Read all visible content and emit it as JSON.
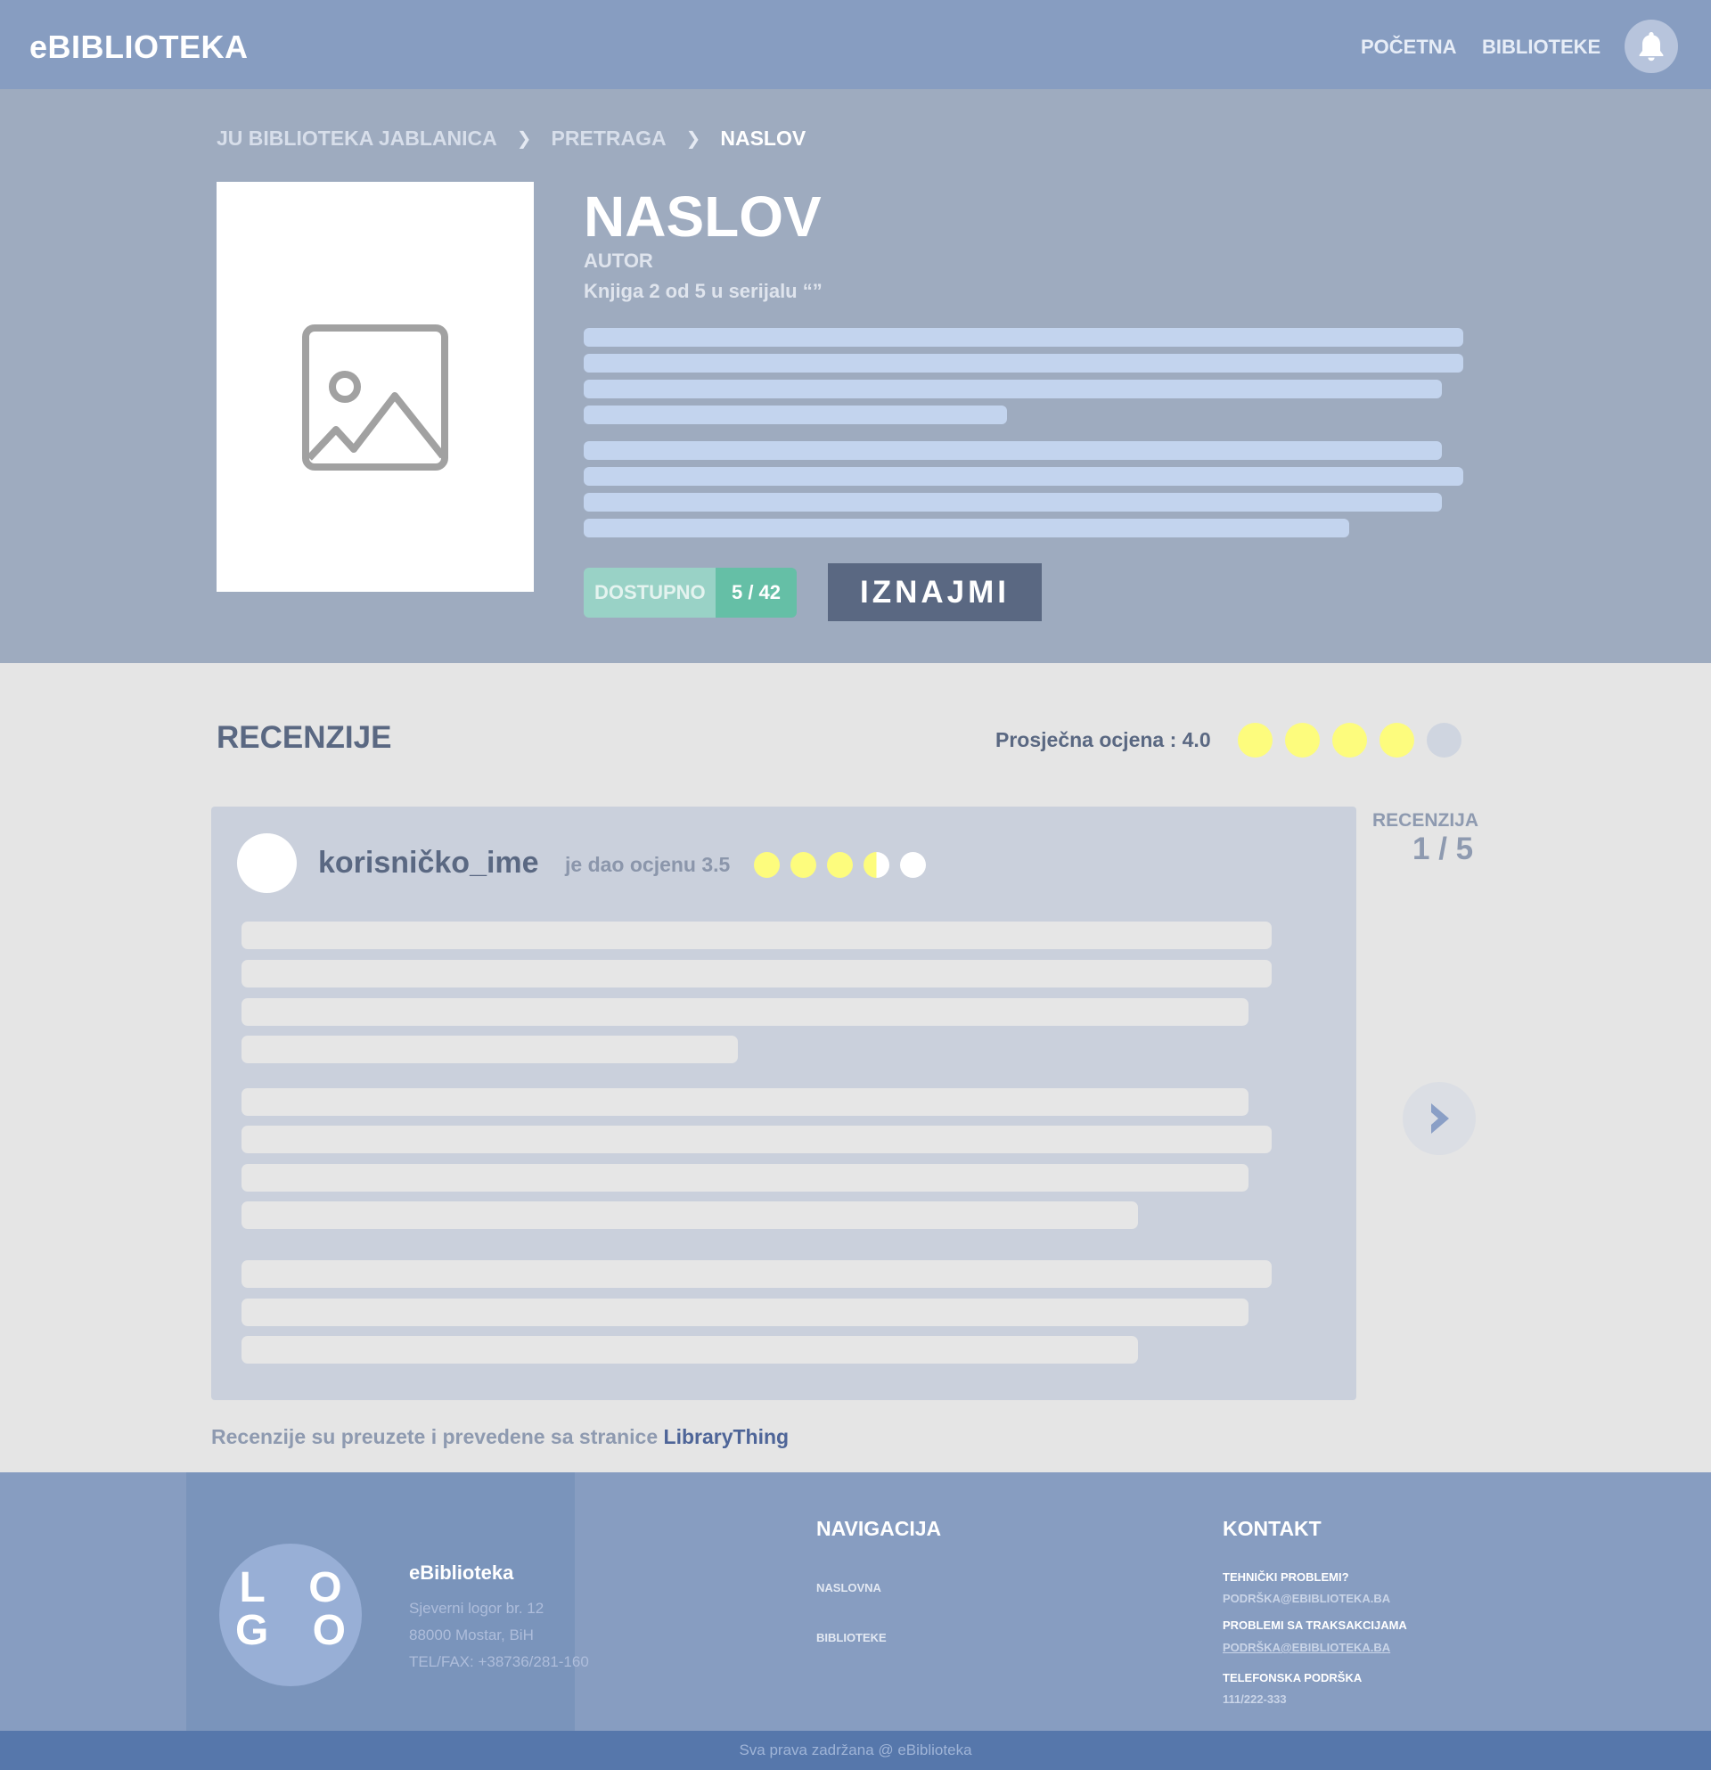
{
  "header": {
    "app_title": "eBIBLIOTEKA",
    "nav": [
      {
        "label": "POČETNA"
      },
      {
        "label": "BIBLIOTEKE"
      }
    ],
    "bell_icon": "bell-icon"
  },
  "breadcrumb": {
    "items": [
      "JU BIBLIOTEKA JABLANICA",
      "PRETRAGA",
      "NASLOV"
    ],
    "separator_icon": "chevron-right-icon"
  },
  "book": {
    "cover_icon": "image-placeholder-icon",
    "title": "NASLOV",
    "author": "AUTOR",
    "series": "Knjiga 2 od 5 u serijalu “”",
    "availability_label": "DOSTUPNO",
    "availability_count": "5 / 42",
    "rent_button": "IZNAJMI"
  },
  "reviews": {
    "heading": "RECENZIJE",
    "average_label": "Prosječna ocjena : 4.0",
    "average_rating": 4.0,
    "max_rating": 5,
    "index_label": "RECENZIJA",
    "index_value": "1 / 5",
    "next_icon": "chevron-right-icon",
    "current": {
      "username": "korisničko_ime",
      "rating_text": "je dao ocjenu 3.5",
      "rating": 3.5
    },
    "source_prefix": "Recenzije su preuzete i prevedene sa stranice",
    "source_link": "LibraryThing"
  },
  "colors": {
    "rating_filled": "#fdfc7d",
    "rating_empty_avg": "#cfd5e0",
    "rating_empty_review": "#ffffff",
    "accent_dark": "#5a6882",
    "available_green": "#65bfa6"
  },
  "footer": {
    "logo_line1": "L O",
    "logo_line2": "G O",
    "brand": "eBiblioteka",
    "address_line1": "Sjeverni logor br. 12",
    "address_line2": "88000 Mostar, BiH",
    "phone_line": "TEL/FAX: +38736/281-160",
    "nav_heading": "NAVIGACIJA",
    "nav_links": [
      "NASLOVNA",
      "BIBLIOTEKE"
    ],
    "contact_heading": "KONTAKT",
    "tech_label": "TEHNIČKI PROBLEMI?",
    "tech_email": "PODRŠKA@EBIBLIOTEKA.BA",
    "trans_label": "PROBLEMI SA TRAKSAKCIJAMA",
    "trans_email": "PODRŠKA@EBIBLIOTEKA.BA",
    "phone_label": "TELEFONSKA PODRŠKA",
    "phone_number": "111/222-333",
    "copyright": "Sva prava zadržana @ eBiblioteka"
  }
}
